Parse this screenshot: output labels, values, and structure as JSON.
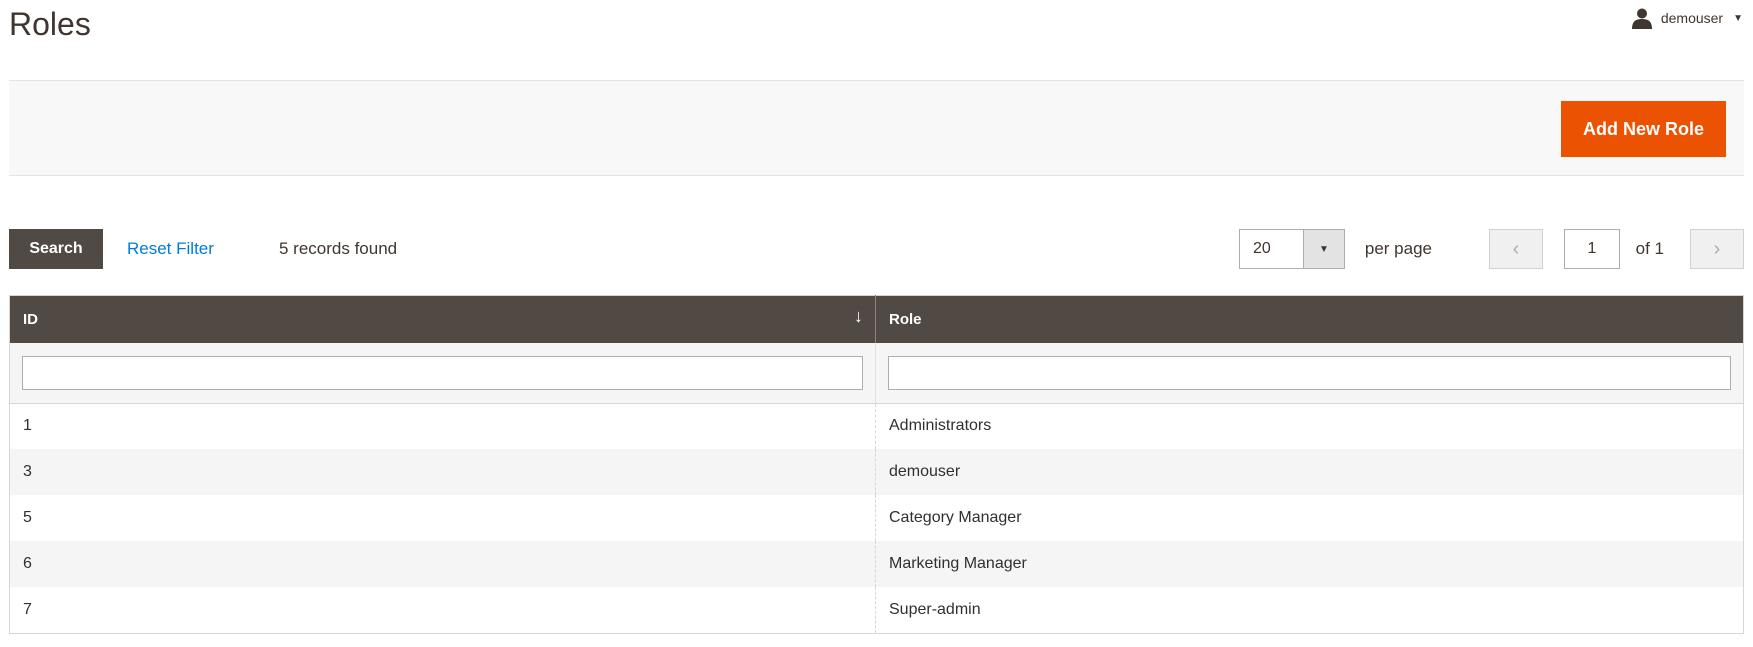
{
  "header": {
    "title": "Roles",
    "user": {
      "name": "demouser",
      "icon": "user-icon"
    }
  },
  "actions": {
    "add_new_role": "Add New Role"
  },
  "toolbar": {
    "search_label": "Search",
    "reset_filter_label": "Reset Filter",
    "records_found": "5 records found",
    "per_page_value": "20",
    "per_page_label": "per page",
    "current_page": "1",
    "page_of": "of 1"
  },
  "grid": {
    "columns": [
      {
        "label": "ID",
        "sort": "↓"
      },
      {
        "label": "Role"
      }
    ],
    "rows": [
      {
        "id": "1",
        "role": "Administrators"
      },
      {
        "id": "3",
        "role": "demouser"
      },
      {
        "id": "5",
        "role": "Category Manager"
      },
      {
        "id": "6",
        "role": "Marketing Manager"
      },
      {
        "id": "7",
        "role": "Super-admin"
      }
    ]
  },
  "colors": {
    "accent": "#eb5202",
    "header_dark": "#514943",
    "link": "#007bdb"
  }
}
